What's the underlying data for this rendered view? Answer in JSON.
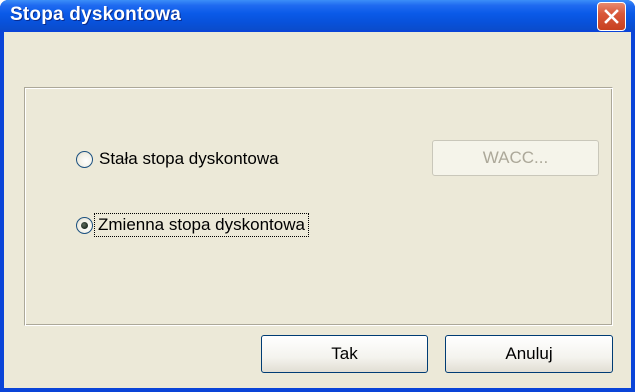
{
  "window": {
    "title": "Stopa dyskontowa"
  },
  "options": [
    {
      "label": "Stała stopa dyskontowa",
      "checked": false
    },
    {
      "label": "Zmienna stopa dyskontowa",
      "checked": true
    }
  ],
  "buttons": {
    "wacc_label": "WACC...",
    "ok_label": "Tak",
    "cancel_label": "Anuluj"
  },
  "colors": {
    "titlebar": "#0A5AE8",
    "dialog_face": "#ECE9D8",
    "close_button": "#D9583A"
  }
}
